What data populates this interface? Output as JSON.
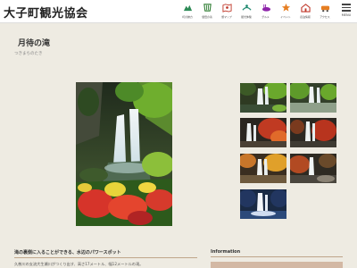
{
  "header": {
    "site_title": "大子町観光協会",
    "nav": [
      {
        "label": "町の魅力",
        "icon": "town-charm-icon",
        "color": "#2e8b57"
      },
      {
        "label": "袋田の滝",
        "icon": "waterfall-icon",
        "color": "#2e7d32"
      },
      {
        "label": "旅マップ",
        "icon": "map-icon",
        "color": "#c0392b"
      },
      {
        "label": "観光体験",
        "icon": "experience-icon",
        "color": "#1f8a70"
      },
      {
        "label": "グルメ",
        "icon": "gourmet-icon",
        "color": "#8e24aa"
      },
      {
        "label": "イベント",
        "icon": "event-icon",
        "color": "#e67e22"
      },
      {
        "label": "宿泊情報",
        "icon": "lodging-icon",
        "color": "#c0392b"
      },
      {
        "label": "アクセス",
        "icon": "access-icon",
        "color": "#e67e22"
      }
    ],
    "menu_label": "MENU"
  },
  "page": {
    "title": "月待の滝",
    "reading": "つきまちのたき"
  },
  "gallery": {
    "thumbnails": [
      {
        "name": "thumb-summer-1"
      },
      {
        "name": "thumb-summer-2"
      },
      {
        "name": "thumb-autumn-1"
      },
      {
        "name": "thumb-autumn-2"
      },
      {
        "name": "thumb-autumn-3"
      },
      {
        "name": "thumb-autumn-4"
      },
      {
        "name": "thumb-winter"
      }
    ]
  },
  "description": {
    "heading": "滝の裏側に入ることができる、水辺のパワースポット",
    "text": "久慈川の支流大生瀬川がつくり出す、高さ17メートル、幅12メートルの滝。"
  },
  "info": {
    "heading": "Information"
  },
  "colors": {
    "background": "#eeebe2",
    "accent": "#bfa58a",
    "info_bar": "#d3b8a4"
  }
}
